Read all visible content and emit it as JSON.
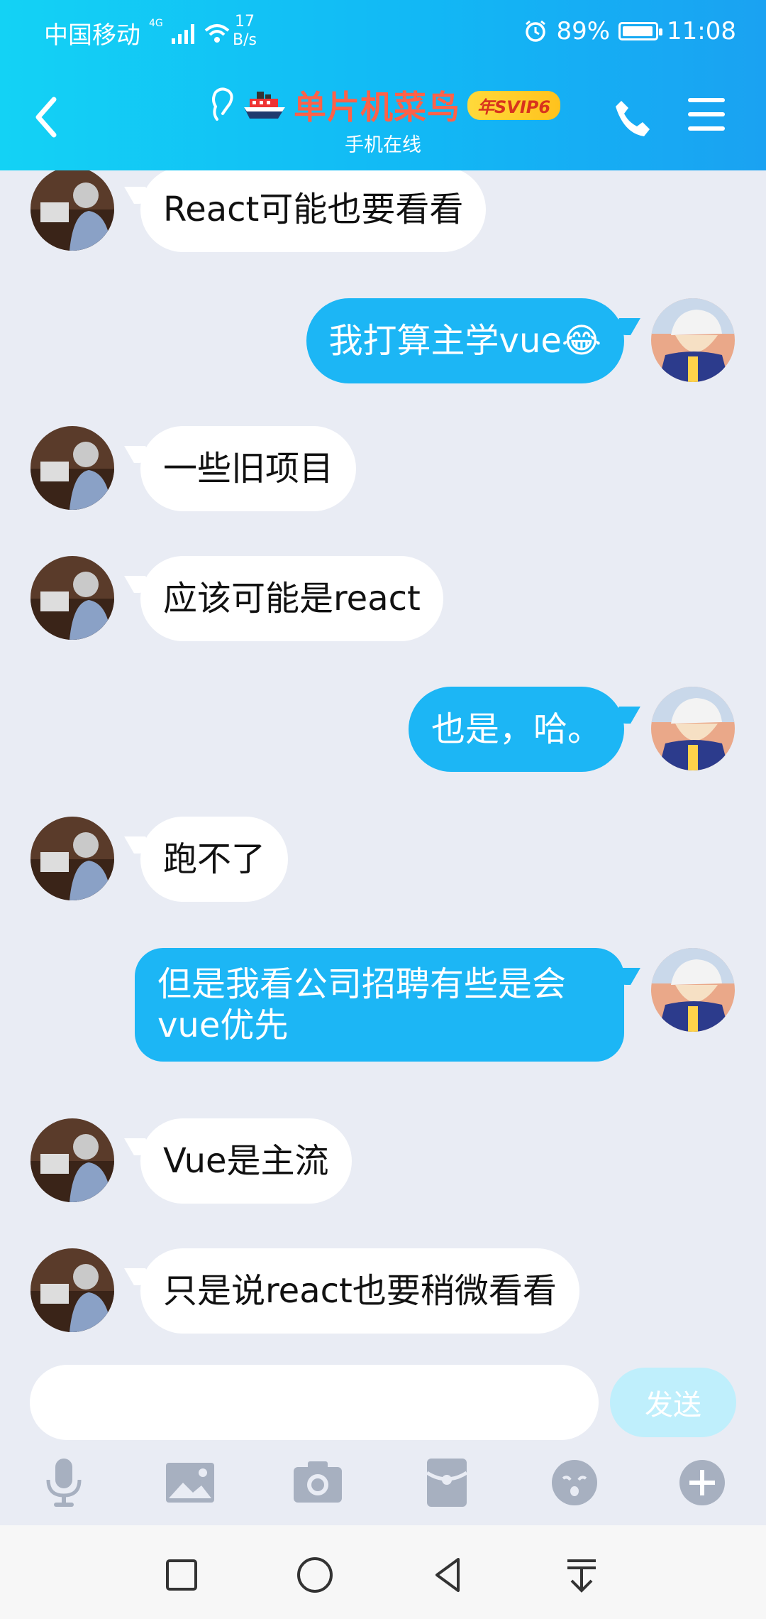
{
  "status_bar": {
    "carrier": "中国移动",
    "network": "4G",
    "speed_value": "17",
    "speed_unit": "B/s",
    "battery": "89%",
    "time": "11:08"
  },
  "header": {
    "title": "单片机菜鸟",
    "vip_badge": "年SVIP6",
    "status": "手机在线"
  },
  "messages": [
    {
      "side": "in",
      "text": "React可能也要看看"
    },
    {
      "side": "out",
      "text": "我打算主学vue😂"
    },
    {
      "side": "in",
      "text": "一些旧项目"
    },
    {
      "side": "in",
      "text": "应该可能是react"
    },
    {
      "side": "out",
      "text": "也是，哈。"
    },
    {
      "side": "in",
      "text": "跑不了"
    },
    {
      "side": "out",
      "text": "但是我看公司招聘有些是会vue优先"
    },
    {
      "side": "in",
      "text": "Vue是主流"
    },
    {
      "side": "in",
      "text": "只是说react也要稍微看看"
    }
  ],
  "composer": {
    "value": "",
    "send_label": "发送"
  },
  "colors": {
    "header_start": "#13d2f5",
    "header_end": "#1aa2f2",
    "outgoing_bubble": "#1cb6f5",
    "incoming_bubble": "#ffffff",
    "title": "#ff6148",
    "background": "#e9ecf4"
  },
  "icons": {
    "toolbar": [
      "microphone-icon",
      "image-icon",
      "camera-icon",
      "red-packet-icon",
      "emoji-icon",
      "plus-icon"
    ],
    "nav": [
      "square-icon",
      "circle-icon",
      "triangle-back-icon",
      "download-icon"
    ]
  }
}
